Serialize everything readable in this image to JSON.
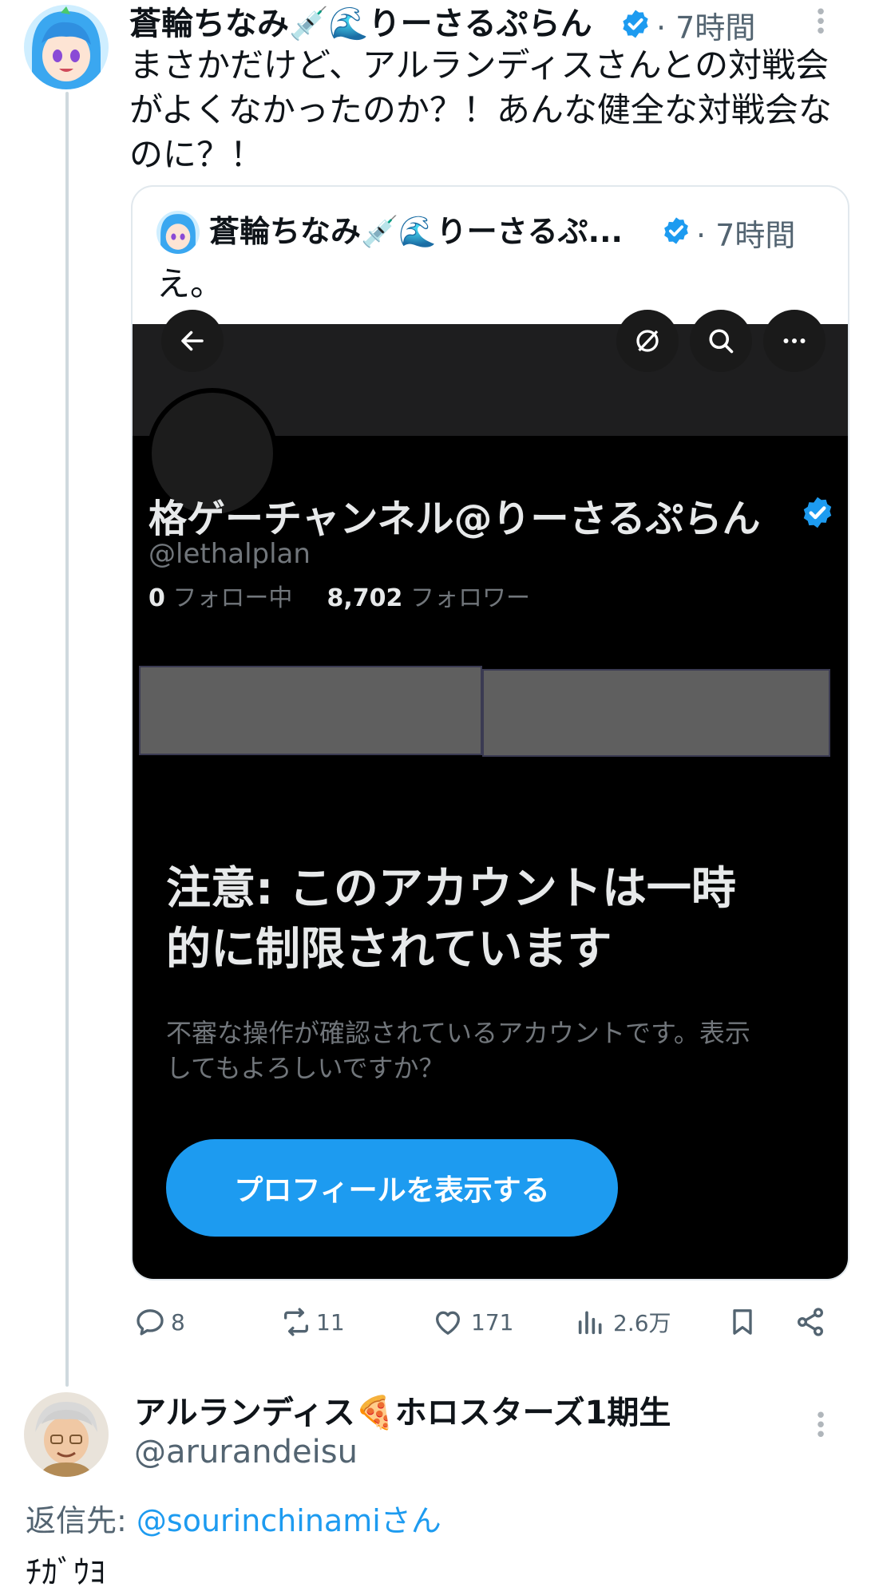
{
  "thread": {
    "tweet": {
      "author_name": "蒼輪ちなみ💉🌊りーさるぷらん",
      "time": "· 7時間",
      "text_lines": [
        "まさかだけど、アルランディスさんとの対戦会",
        "がよくなかったのか？！あんな健全な対戦会な",
        "のに？！"
      ],
      "more_icon": "more-vertical-icon",
      "quoted": {
        "author_name": "蒼輪ちなみ💉🌊りーさるぷ...",
        "time": "· 7時間",
        "text": "え。",
        "screenshot": {
          "profile_name": "格ゲーチャンネル@りーさるぷらん",
          "handle": "@lethalplan",
          "following_count": "0",
          "following_label": "フォロー中",
          "followers_count": "8,702",
          "followers_label": "フォロワー",
          "warning_title_lines": [
            "注意: このアカウントは一時",
            "的に制限されています"
          ],
          "warning_body_lines": [
            "不審な操作が確認されているアカウントです。表示",
            "してもよろしいですか？"
          ],
          "view_button_label": "プロフィールを表示する"
        }
      },
      "actions": {
        "replies": "8",
        "retweets": "11",
        "likes": "171",
        "views": "2.6万"
      }
    },
    "reply": {
      "author_name": "アルランディス🍕ホロスターズ1期生",
      "handle": "@arurandeisu",
      "reply_to_prefix": "返信先: ",
      "reply_to_handle": "@sourinchinamiさん",
      "text": "ﾁｶﾞｳﾖ"
    }
  },
  "colors": {
    "accent": "#1d9bf0",
    "text": "#0f1419",
    "muted": "#536471",
    "thread_line": "#cfd9de"
  }
}
